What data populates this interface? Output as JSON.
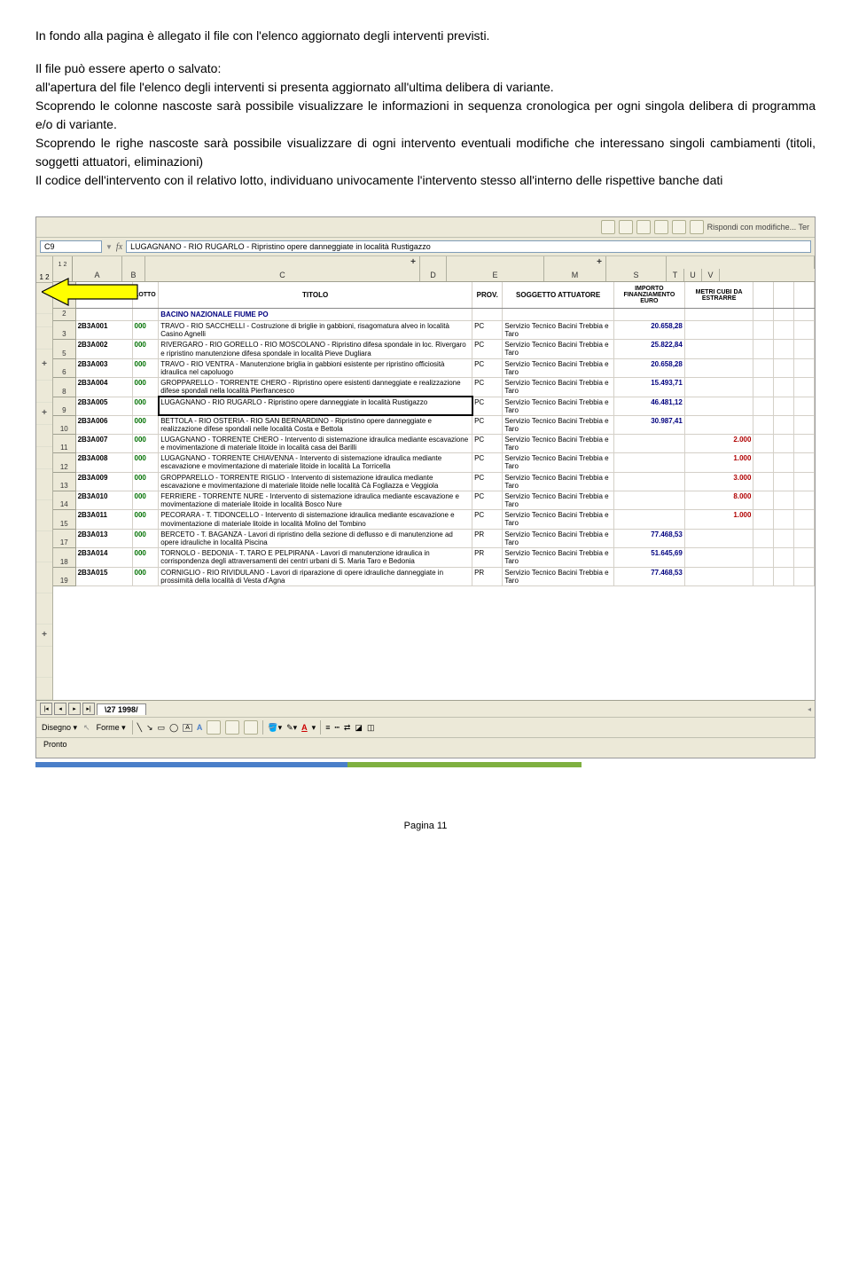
{
  "paragraphs": {
    "p1": "In fondo alla pagina è allegato il file con l'elenco aggiornato degli interventi previsti.",
    "p2": "Il file può essere aperto o salvato:",
    "p3": "all'apertura del file l'elenco degli interventi si presenta aggiornato all'ultima delibera di variante.",
    "p4": "Scoprendo le colonne nascoste sarà possibile visualizzare le informazioni in sequenza cronologica per ogni singola delibera di programma e/o di variante.",
    "p5": "Scoprendo le righe nascoste sarà possibile visualizzare di ogni intervento eventuali modifiche che interessano singoli cambiamenti (titoli, soggetti attuatori, eliminazioni)",
    "p6": "Il codice dell'intervento con il relativo lotto, individuano univocamente l'intervento stesso all'interno delle rispettive banche dati"
  },
  "spreadsheet": {
    "toolbar_right_label": "Rispondi con modifiche... Ter",
    "namebox": "C9",
    "fx_label": "fx",
    "formula": "LUGAGNANO - RIO RUGARLO - Ripristino opere danneggiate in località Rustigazzo",
    "outline_levels": "1 2",
    "col_labels": {
      "a": "A",
      "b": "B",
      "c": "C",
      "d": "D",
      "e": "E",
      "m": "M",
      "s": "S",
      "t": "T",
      "u": "U",
      "v": "V"
    },
    "row_outline_levels": "1 2",
    "headers": {
      "codice": "CODICE",
      "lotto": "LOTTO",
      "titolo": "TITOLO",
      "prov": "PROV.",
      "soggetto": "SOGGETTO ATTUATORE",
      "importo": "IMPORTO FINANZIAMENTO EURO",
      "metri": "METRI CUBI DA ESTRARRE"
    },
    "section_title": "BACINO NAZIONALE FIUME PO",
    "rows": [
      {
        "rn": "3",
        "codice": "2B3A001",
        "lotto": "000",
        "titolo": "TRAVO - RIO SACCHELLI - Costruzione di briglie in gabbioni, risagomatura alveo in località Casino Agnelli",
        "prov": "PC",
        "soggetto": "Servizio Tecnico Bacini Trebbia e Taro",
        "importo": "20.658,28",
        "metri": ""
      },
      {
        "rn": "5",
        "codice": "2B3A002",
        "lotto": "000",
        "titolo": "RIVERGARO - RIO GORELLO - RIO MOSCOLANO - Ripristino difesa spondale in loc. Rivergaro e ripristino manutenzione difesa spondale in località Pieve Dugliara",
        "prov": "PC",
        "soggetto": "Servizio Tecnico Bacini Trebbia e Taro",
        "importo": "25.822,84",
        "metri": "",
        "plus": true
      },
      {
        "rn": "6",
        "codice": "2B3A003",
        "lotto": "000",
        "titolo": "TRAVO - RIO VENTRA - Manutenzione briglia in gabbioni esistente per ripristino officiosità idraulica nel capoluogo",
        "prov": "PC",
        "soggetto": "Servizio Tecnico Bacini Trebbia e Taro",
        "importo": "20.658,28",
        "metri": ""
      },
      {
        "rn": "8",
        "codice": "2B3A004",
        "lotto": "000",
        "titolo": "GROPPARELLO - TORRENTE CHERO - Ripristino opere esistenti danneggiate e realizzazione difese spondali nella località Pierfrancesco",
        "prov": "PC",
        "soggetto": "Servizio Tecnico Bacini Trebbia e Taro",
        "importo": "15.493,71",
        "metri": "",
        "plus": true
      },
      {
        "rn": "9",
        "codice": "2B3A005",
        "lotto": "000",
        "titolo": "LUGAGNANO - RIO RUGARLO - Ripristino opere danneggiate in località Rustigazzo",
        "prov": "PC",
        "soggetto": "Servizio Tecnico Bacini Trebbia e Taro",
        "importo": "46.481,12",
        "metri": "",
        "selected": true
      },
      {
        "rn": "10",
        "codice": "2B3A006",
        "lotto": "000",
        "titolo": "BETTOLA - RIO OSTERIA - RIO SAN BERNARDINO - Ripristino opere danneggiate e realizzazione difese spondali nelle località Costa e Bettola",
        "prov": "PC",
        "soggetto": "Servizio Tecnico Bacini Trebbia e Taro",
        "importo": "30.987,41",
        "metri": ""
      },
      {
        "rn": "11",
        "codice": "2B3A007",
        "lotto": "000",
        "titolo": "LUGAGNANO - TORRENTE CHERO - Intervento di sistemazione idraulica mediante escavazione e movimentazione di materiale litoide in località casa dei Barilli",
        "prov": "PC",
        "soggetto": "Servizio Tecnico Bacini Trebbia e Taro",
        "importo": "",
        "metri": "2.000"
      },
      {
        "rn": "12",
        "codice": "2B3A008",
        "lotto": "000",
        "titolo": "LUGAGNANO - TORRENTE CHIAVENNA - Intervento di sistemazione idraulica mediante escavazione e movimentazione di materiale litoide in località La Torricella",
        "prov": "PC",
        "soggetto": "Servizio Tecnico Bacini Trebbia e Taro",
        "importo": "",
        "metri": "1.000"
      },
      {
        "rn": "13",
        "codice": "2B3A009",
        "lotto": "000",
        "titolo": "GROPPARELLO - TORRENTE RIGLIO - Intervento di sistemazione idraulica mediante escavazione e movimentazione di materiale litoide nelle località Cà Fogliazza e Veggiola",
        "prov": "PC",
        "soggetto": "Servizio Tecnico Bacini Trebbia e Taro",
        "importo": "",
        "metri": "3.000"
      },
      {
        "rn": "14",
        "codice": "2B3A010",
        "lotto": "000",
        "titolo": "FERRIERE - TORRENTE NURE - Intervento di sistemazione idraulica mediante escavazione e movimentazione di materiale litoide in località Bosco Nure",
        "prov": "PC",
        "soggetto": "Servizio Tecnico Bacini Trebbia e Taro",
        "importo": "",
        "metri": "8.000"
      },
      {
        "rn": "15",
        "codice": "2B3A011",
        "lotto": "000",
        "titolo": "PECORARA - T. TIDONCELLO - Intervento di sistemazione idraulica mediante escavazione e movimentazione di materiale litoide in località Molino del Tombino",
        "prov": "PC",
        "soggetto": "Servizio Tecnico Bacini Trebbia e Taro",
        "importo": "",
        "metri": "1.000"
      },
      {
        "rn": "17",
        "codice": "2B3A013",
        "lotto": "000",
        "titolo": "BERCETO - T. BAGANZA - Lavori di ripristino della sezione di deflusso e di manutenzione ad opere idrauliche in località Piscina",
        "prov": "PR",
        "soggetto": "Servizio Tecnico Bacini Trebbia e Taro",
        "importo": "77.468,53",
        "metri": "",
        "plus": true
      },
      {
        "rn": "18",
        "codice": "2B3A014",
        "lotto": "000",
        "titolo": "TORNOLO - BEDONIA - T. TARO E PELPIRANA - Lavori di manutenzione idraulica in corrispondenza degli attraversamenti dei centri urbani di S. Maria Taro e Bedonia",
        "prov": "PR",
        "soggetto": "Servizio Tecnico Bacini Trebbia e Taro",
        "importo": "51.645,69",
        "metri": ""
      },
      {
        "rn": "19",
        "codice": "2B3A015",
        "lotto": "000",
        "titolo": "CORNIGLIO - RIO RIVIDULANO - Lavori di riparazione di opere idrauliche danneggiate in prossimità della località di Vesta d'Agna",
        "prov": "PR",
        "soggetto": "Servizio Tecnico Bacini Trebbia e Taro",
        "importo": "77.468,53",
        "metri": ""
      }
    ],
    "sheet_tab": "27 1998",
    "draw_toolbar": {
      "disegno": "Disegno ▾",
      "forme": "Forme ▾"
    },
    "status": "Pronto"
  },
  "footer": "Pagina 11"
}
